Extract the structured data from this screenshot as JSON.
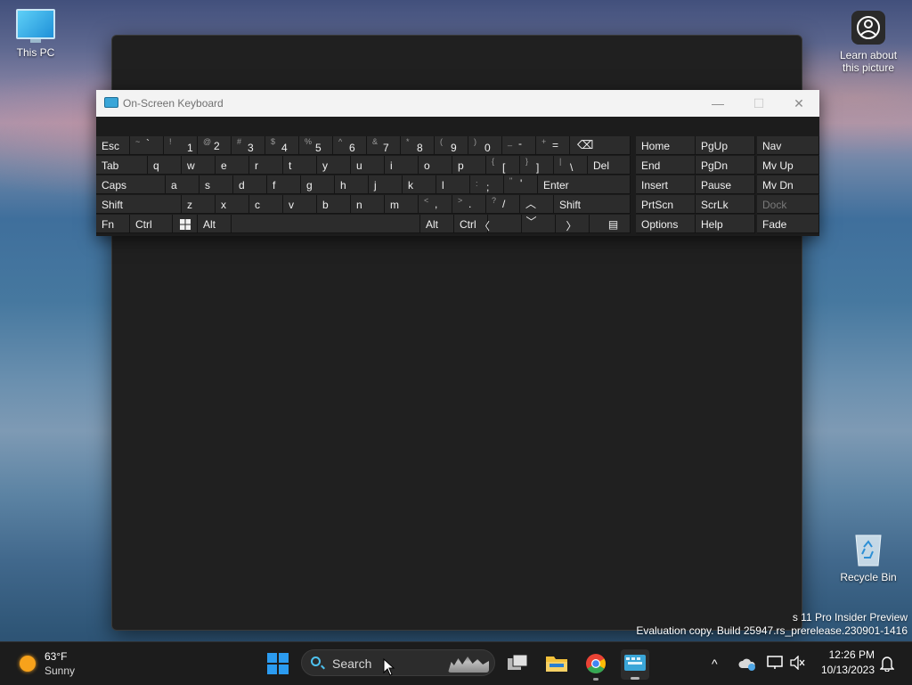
{
  "desktop": {
    "this_pc": "This PC",
    "learn_line1": "Learn about",
    "learn_line2": "this picture",
    "recycle_bin": "Recycle Bin",
    "watermark_line1": "s 11 Pro Insider Preview",
    "watermark_line2": "Evaluation copy. Build 25947.rs_prerelease.230901-1416"
  },
  "osk": {
    "title": "On-Screen Keyboard",
    "title_buttons": {
      "minimize": "—",
      "maximize": "☐",
      "close": "✕"
    },
    "row1": {
      "esc": "Esc",
      "num": [
        {
          "sub": "~",
          "main": "`"
        },
        {
          "sub": "!",
          "main": "1"
        },
        {
          "sub": "@",
          "main": "2"
        },
        {
          "sub": "#",
          "main": "3"
        },
        {
          "sub": "$",
          "main": "4"
        },
        {
          "sub": "%",
          "main": "5"
        },
        {
          "sub": "^",
          "main": "6"
        },
        {
          "sub": "&",
          "main": "7"
        },
        {
          "sub": "*",
          "main": "8"
        },
        {
          "sub": "(",
          "main": "9"
        },
        {
          "sub": ")",
          "main": "0"
        },
        {
          "sub": "_",
          "main": "-"
        },
        {
          "sub": "+",
          "main": "="
        }
      ],
      "backspace": "⌫"
    },
    "row2": {
      "tab": "Tab",
      "letters": [
        "q",
        "w",
        "e",
        "r",
        "t",
        "y",
        "u",
        "i",
        "o",
        "p"
      ],
      "brackets": [
        {
          "sub": "{",
          "main": "["
        },
        {
          "sub": "}",
          "main": "]"
        },
        {
          "sub": "|",
          "main": "\\"
        }
      ],
      "del": "Del"
    },
    "row3": {
      "caps": "Caps",
      "letters": [
        "a",
        "s",
        "d",
        "f",
        "g",
        "h",
        "j",
        "k",
        "l"
      ],
      "punct": [
        {
          "sub": ":",
          "main": ";"
        },
        {
          "sub": "\"",
          "main": "'"
        }
      ],
      "enter": "Enter"
    },
    "row4": {
      "shift_left": "Shift",
      "letters": [
        "z",
        "x",
        "c",
        "v",
        "b",
        "n",
        "m"
      ],
      "punct": [
        {
          "sub": "<",
          "main": ","
        },
        {
          "sub": ">",
          "main": "."
        },
        {
          "sub": "?",
          "main": "/"
        }
      ],
      "up": "︿",
      "shift_right": "Shift"
    },
    "row5": {
      "fn": "Fn",
      "ctrl_left": "Ctrl",
      "alt_left": "Alt",
      "alt_right": "Alt",
      "ctrl_right": "Ctrl",
      "left": "〈",
      "down": "﹀",
      "right": "〉",
      "menu": "▤"
    },
    "nav": {
      "home": "Home",
      "pgup": "PgUp",
      "nav": "Nav",
      "end": "End",
      "pgdn": "PgDn",
      "mvup": "Mv Up",
      "insert": "Insert",
      "pause": "Pause",
      "mvdn": "Mv Dn",
      "prtscn": "PrtScn",
      "scrlk": "ScrLk",
      "dock": "Dock",
      "options": "Options",
      "help": "Help",
      "fade": "Fade"
    }
  },
  "taskbar": {
    "weather_temp": "63°F",
    "weather_cond": "Sunny",
    "search_placeholder": "Search",
    "time": "12:26 PM",
    "date": "10/13/2023",
    "tray_overflow": "^"
  },
  "colors": {
    "start_blue": "#2b9bf0",
    "chrome_red": "#ea4335",
    "chrome_yellow": "#fbbc05",
    "chrome_green": "#34a853",
    "folder_yellow": "#f3c13a",
    "weather_sun": "#f7a21b"
  },
  "icons": {
    "search": "search-icon",
    "start": "windows-start-icon",
    "chrome": "chrome-icon",
    "file_explorer": "folder-icon",
    "task_view": "task-view-icon",
    "osk_app": "keyboard-icon",
    "bell": "notification-bell-icon"
  }
}
